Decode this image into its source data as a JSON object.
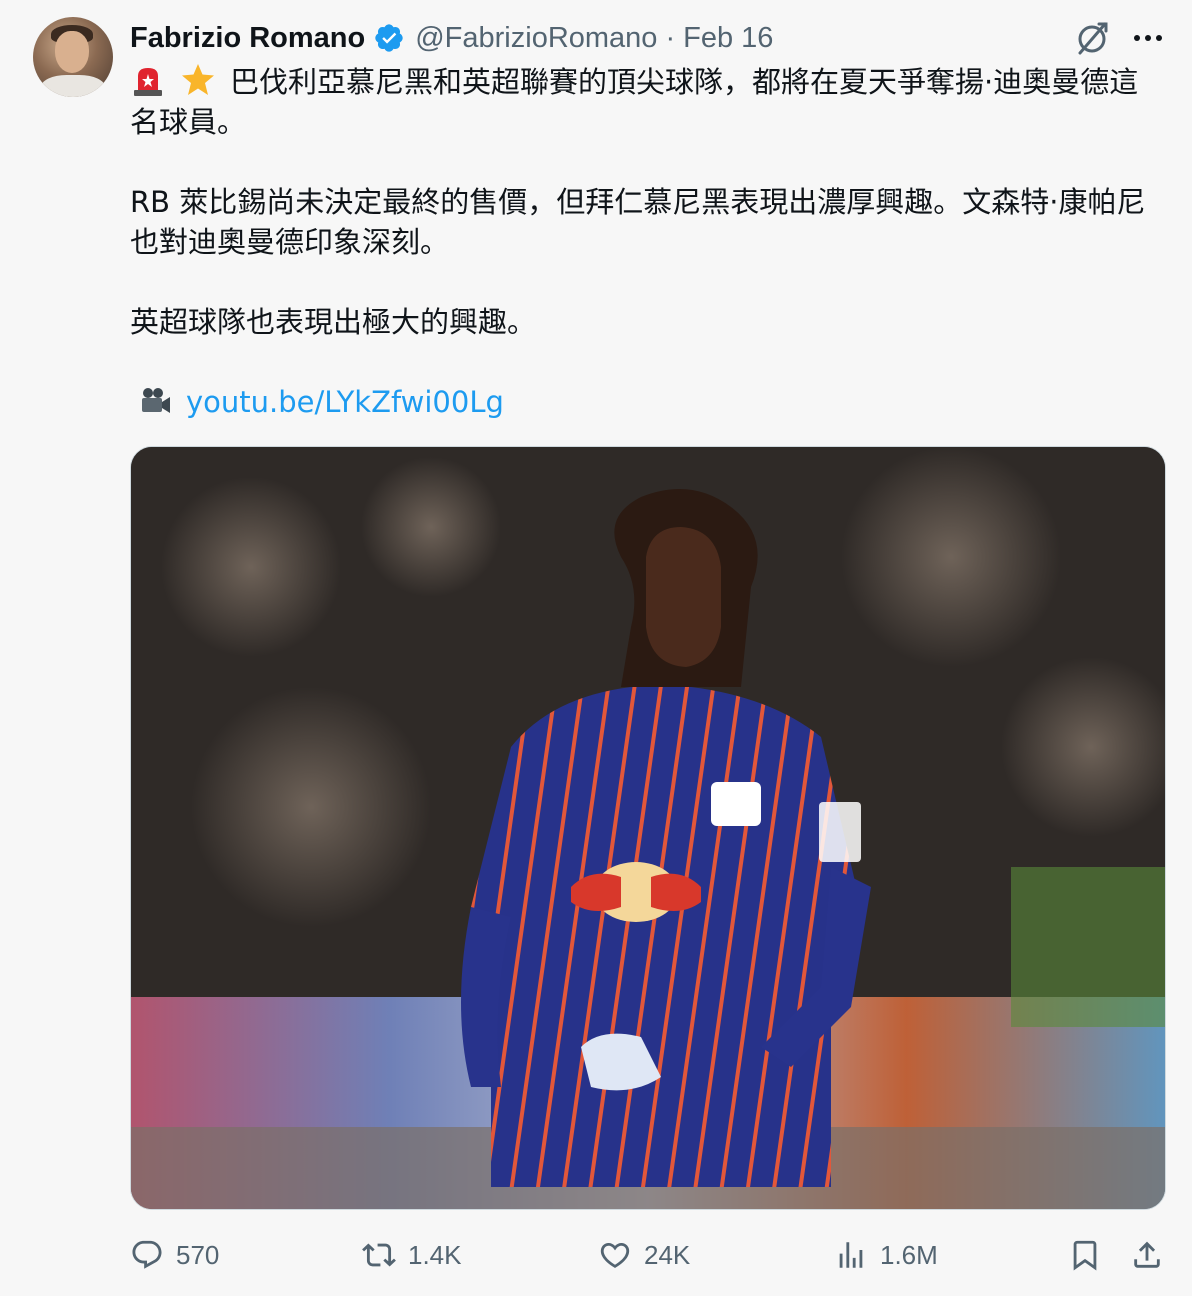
{
  "author": {
    "name": "Fabrizio Romano",
    "handle": "@FabrizioRomano",
    "separator": "·",
    "date": "Feb 16"
  },
  "tweet": {
    "line1_emojis": [
      "siren-emoji",
      "star-emoji"
    ],
    "paragraph1": "巴伐利亞慕尼黑和英超聯賽的頂尖球隊，都將在夏天爭奪揚·迪奧曼德這名球員。",
    "paragraph2": "RB 萊比錫尚未決定最終的售價，但拜仁慕尼黑表現出濃厚興趣。文森特·康帕尼也對迪奧曼德印象深刻。",
    "paragraph3": "英超球隊也表現出極大的興趣。",
    "link_icon": "movie-camera-emoji",
    "link_text": "youtu.be/LYkZfwi00Lg"
  },
  "media": {
    "description_icon": "photo"
  },
  "actions": {
    "replies": "570",
    "retweets": "1.4K",
    "likes": "24K",
    "views": "1.6M"
  },
  "colors": {
    "link": "#1d9bf0",
    "verified": "#1d9bf0",
    "secondary_text": "#536471"
  }
}
